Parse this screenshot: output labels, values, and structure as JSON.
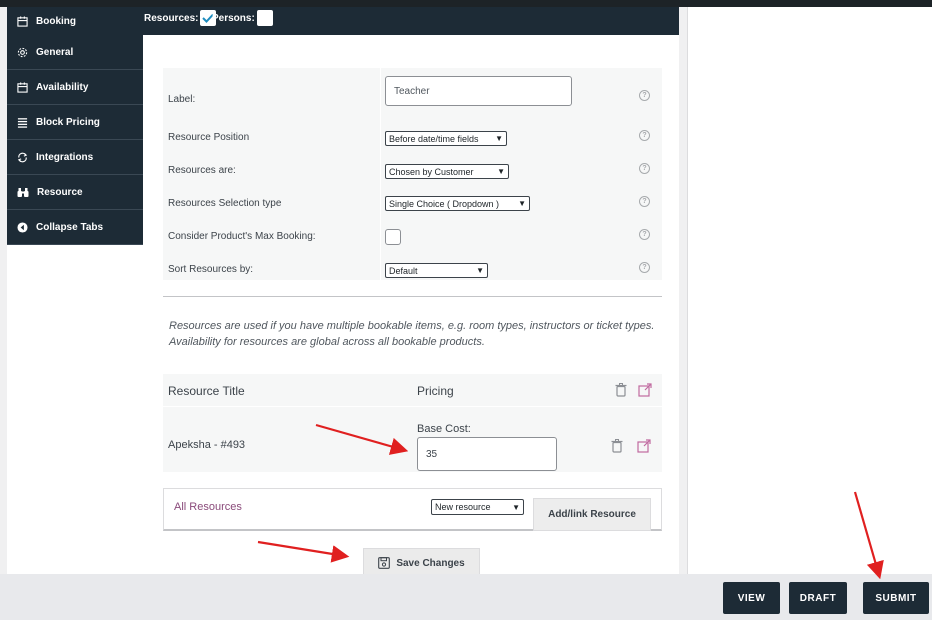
{
  "header": {
    "booking_tab": "Booking",
    "resources_label": "Resources:",
    "resources_checked": true,
    "persons_label": "Persons:",
    "persons_checked": false
  },
  "sidebar": {
    "items": [
      {
        "label": "General",
        "icon": "gear-icon"
      },
      {
        "label": "Availability",
        "icon": "calendar-icon"
      },
      {
        "label": "Block Pricing",
        "icon": "list-icon"
      },
      {
        "label": "Integrations",
        "icon": "sync-icon"
      },
      {
        "label": "Resource",
        "icon": "binoculars-icon"
      },
      {
        "label": "Collapse Tabs",
        "icon": "collapse-icon"
      }
    ]
  },
  "form": {
    "label_label": "Label:",
    "label_value": "Teacher",
    "position_label": "Resource Position",
    "position_value": "Before date/time fields",
    "resources_are_label": "Resources are:",
    "resources_are_value": "Chosen by Customer",
    "selection_label": "Resources Selection type",
    "selection_value": "Single Choice ( Dropdown )",
    "max_booking_label": "Consider Product's Max Booking:",
    "max_booking_checked": false,
    "sort_label": "Sort Resources by:",
    "sort_value": "Default",
    "help_glyph": "?"
  },
  "description": "Resources are used if you have multiple bookable items, e.g. room types, instructors or ticket types. Availability for resources are global across all bookable products.",
  "resources_table": {
    "col_title": "Resource Title",
    "col_pricing": "Pricing",
    "rows": [
      {
        "title": "Apeksha - #493",
        "cost_label": "Base Cost:",
        "cost_value": "35"
      }
    ]
  },
  "add_bar": {
    "all_resources": "All Resources",
    "new_resource": "New resource",
    "add_link_button": "Add/link Resource"
  },
  "save_button": "Save Changes",
  "bottom_bar": {
    "view": "VIEW",
    "draft": "DRAFT",
    "submit": "SUBMIT"
  },
  "colors": {
    "dark": "#1d2b36",
    "arrow": "#e02020",
    "link": "#8a4a7a",
    "check": "#1e8cbe"
  }
}
